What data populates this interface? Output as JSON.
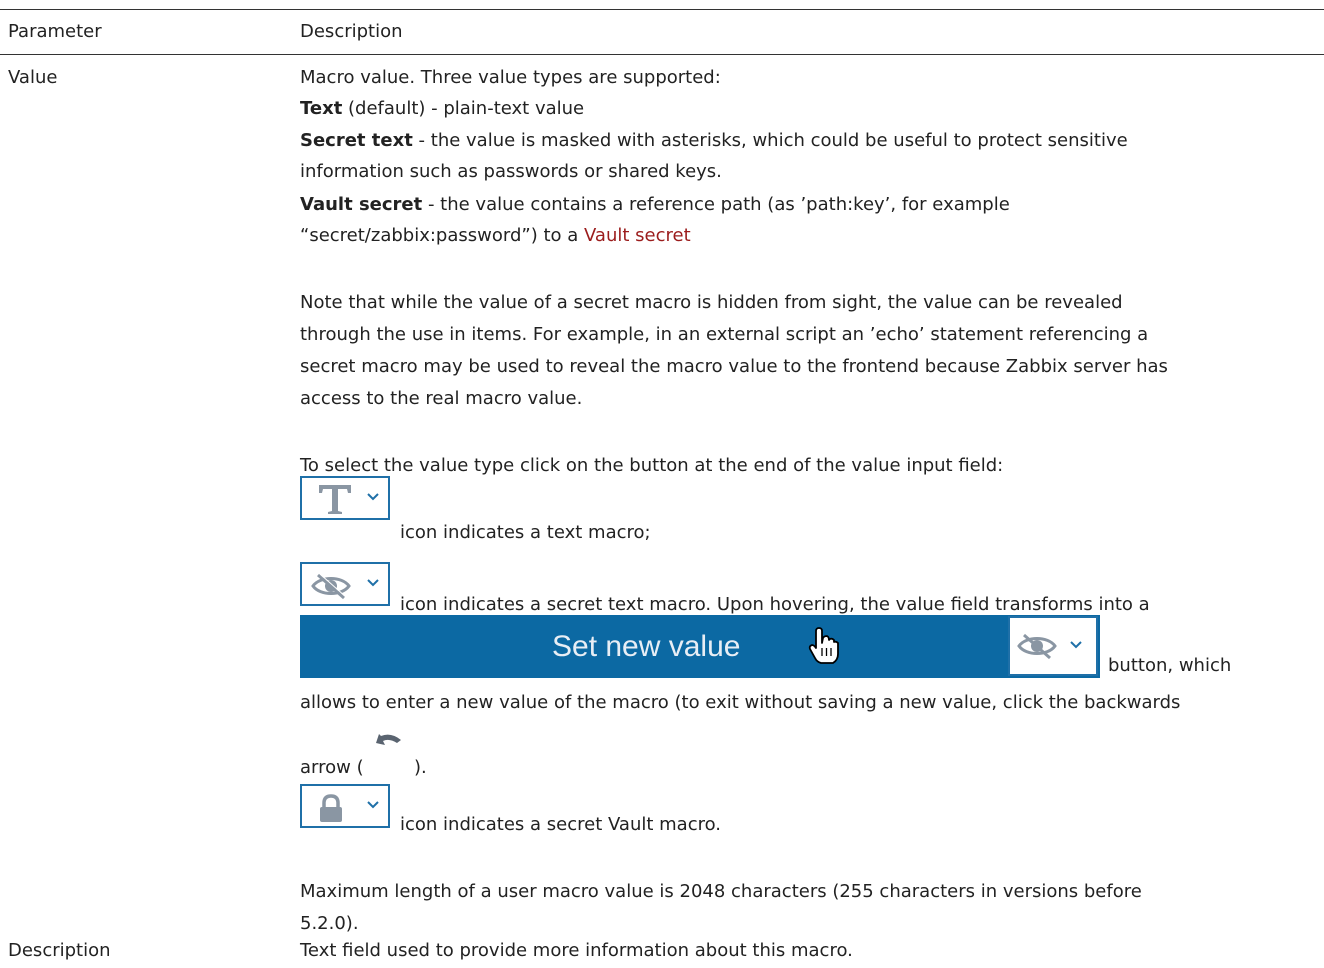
{
  "table": {
    "headers": [
      "Parameter",
      "Description"
    ],
    "rows": [
      {
        "parameter": "Value",
        "intro": "Macro value. Three value types are supported:",
        "types": {
          "text": {
            "name": "Text",
            "desc": " (default) - plain-text value"
          },
          "secret": {
            "name": "Secret text",
            "desc_line1": " - the value is masked with asterisks, which could be useful to protect sensitive",
            "desc_line2": "information such as passwords or shared keys."
          },
          "vault": {
            "name": "Vault secret",
            "desc_line1": " - the value contains a reference path (as ’path:key’, for example",
            "desc_line2": "“secret/zabbix:password”) to a ",
            "link": "Vault secret"
          }
        },
        "note": [
          "Note that while the value of a secret macro is hidden from sight, the value can be revealed",
          "through the use in items. For example, in an external script an ’echo’ statement referencing a",
          "secret macro may be used to reveal the macro value to the frontend because Zabbix server has",
          "access to the real macro value."
        ],
        "select_instruction": "To select the value type click on the button at the end of the value input field:",
        "icon_text_caption": "icon indicates a text macro;",
        "icon_secret_caption": "icon indicates a secret text macro. Upon hovering, the value field transforms into a",
        "set_new_value_label": "Set new value",
        "button_which": "button, which",
        "allows_line": "allows to enter a new value of the macro (to exit without saving a new value, click the backwards",
        "arrow_prefix": "arrow (",
        "arrow_suffix": ").",
        "icon_vault_caption": "icon indicates a secret Vault macro.",
        "max_length": [
          "Maximum length of a user macro value is 2048 characters (255 characters in versions before",
          "5.2.0)."
        ]
      },
      {
        "parameter": "Description",
        "description": "Text field used to provide more information about this macro."
      }
    ]
  },
  "icons": {
    "text_type": "text-type-icon",
    "secret_type": "eye-slash-icon",
    "vault_type": "lock-icon",
    "dropdown": "chevron-down-icon",
    "cursor": "hand-cursor-icon",
    "undo": "undo-arrow-icon"
  },
  "colors": {
    "link": "#9b1c1c",
    "button_border": "#1f70a8",
    "set_value_bar": "#0c69a3",
    "icon_gray": "#8a96a3"
  }
}
